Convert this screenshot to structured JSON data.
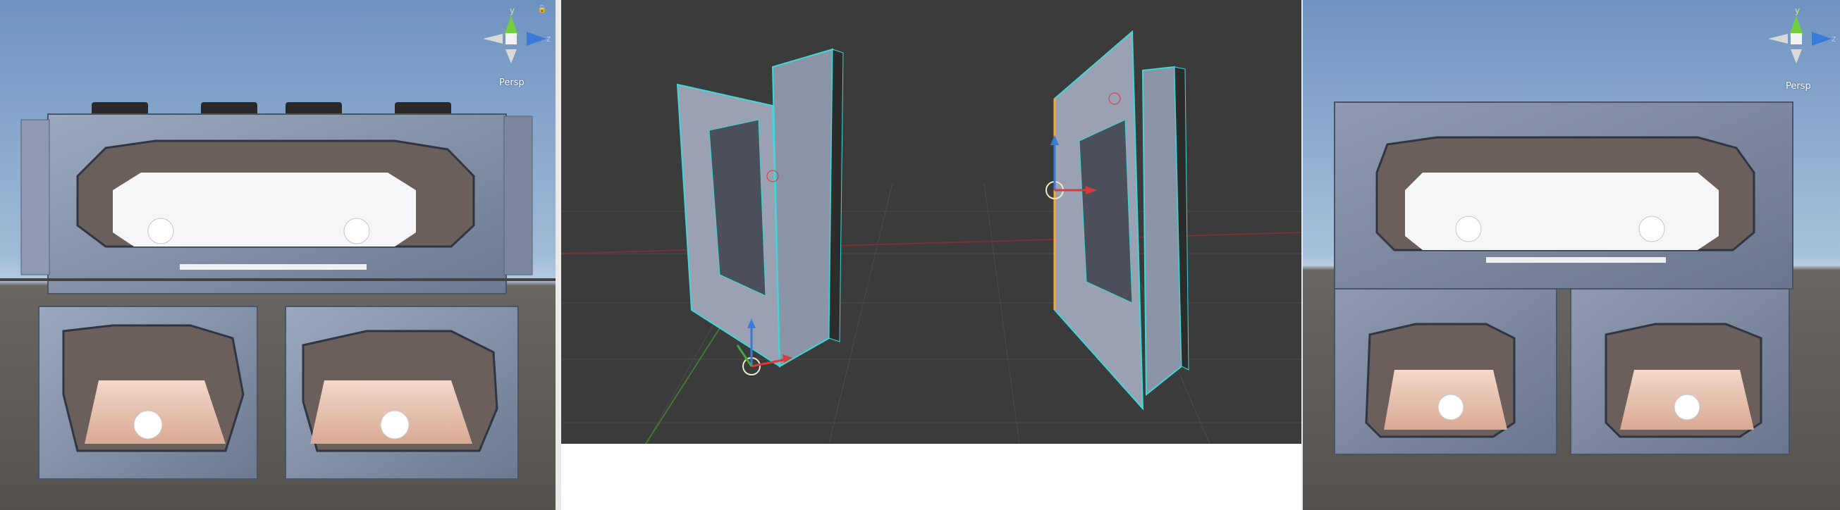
{
  "viewports": {
    "left": {
      "projection_label": "Persp",
      "lock_glyph": "🔒"
    },
    "middle": {},
    "right": {
      "projection_label": "Persp"
    }
  },
  "gizmo": {
    "y_axis": "y",
    "z_axis": "z"
  },
  "colors": {
    "sky_top": "#6e92c0",
    "sky_horizon": "#b6cde2",
    "ground": "#5e5a55",
    "blender_bg": "#3b3b3b",
    "wire": "#3fd8d8",
    "panel_face": "#9aa1b3",
    "gizmo_y": "#6fcf3f",
    "gizmo_z": "#3b7bd8"
  }
}
